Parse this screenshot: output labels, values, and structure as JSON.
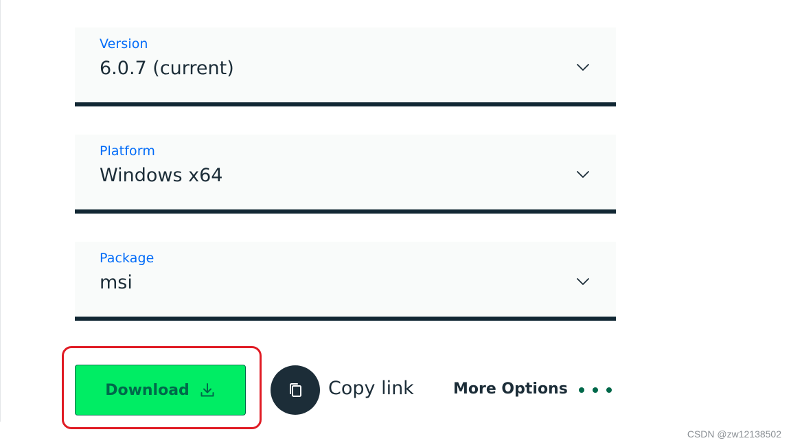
{
  "selects": {
    "version": {
      "label": "Version",
      "value": "6.0.7 (current)"
    },
    "platform": {
      "label": "Platform",
      "value": "Windows x64"
    },
    "package": {
      "label": "Package",
      "value": "msi"
    }
  },
  "actions": {
    "download_label": "Download",
    "copy_link_label": "Copy link",
    "more_options_label": "More Options"
  },
  "icons": {
    "chevron": "chevron-down-icon",
    "download": "download-icon",
    "copy": "copy-icon",
    "more": "more-dots-icon"
  },
  "watermark": "CSDN @zw12138502",
  "colors": {
    "label_blue": "#016bf8",
    "text_dark": "#1c2d38",
    "field_bg": "#f9fbfa",
    "underline": "#112733",
    "download_green": "#00ed64",
    "download_text": "#00684a",
    "highlight_red": "#e01b24"
  }
}
